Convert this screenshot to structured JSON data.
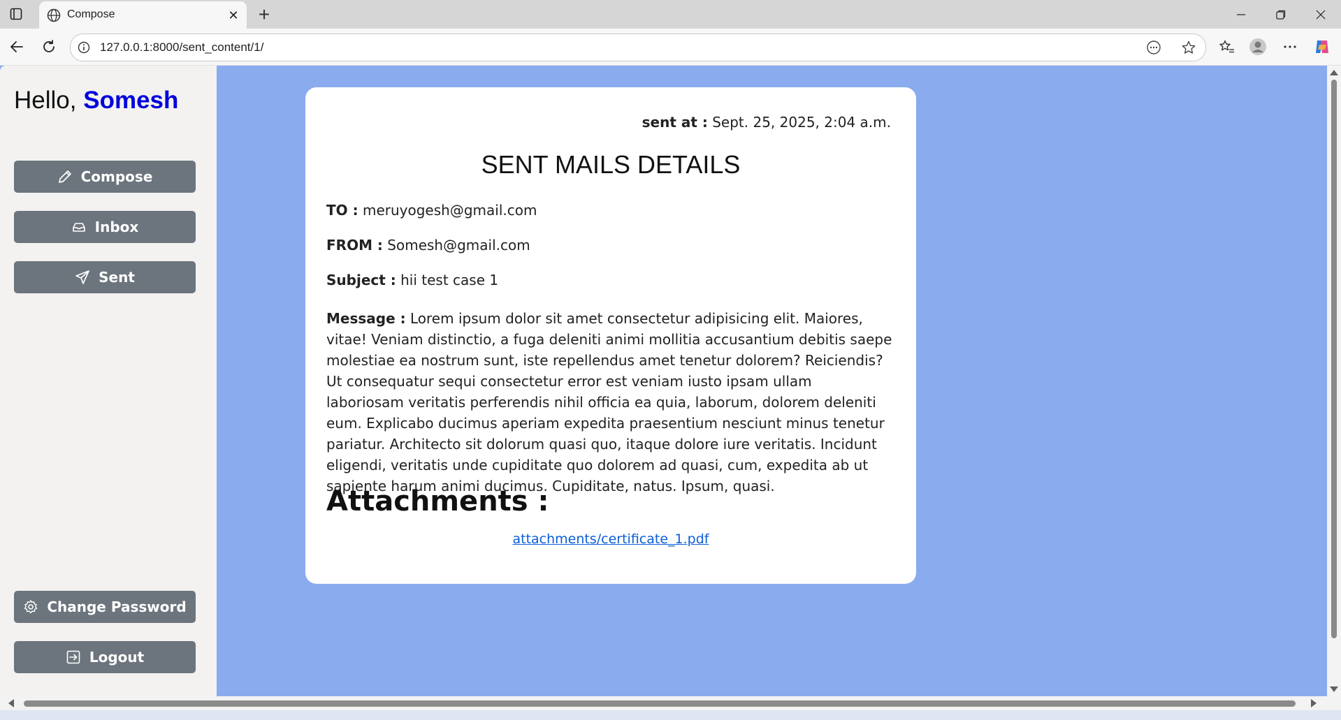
{
  "browser": {
    "tab_title": "Compose",
    "url": "127.0.0.1:8000/sent_content/1/"
  },
  "sidebar": {
    "greeting_prefix": "Hello,",
    "username": "Somesh",
    "nav": [
      {
        "label": "Compose",
        "icon": "pencil-icon"
      },
      {
        "label": "Inbox",
        "icon": "inbox-icon"
      },
      {
        "label": "Sent",
        "icon": "send-icon"
      }
    ],
    "bottom": [
      {
        "label": "Change Password",
        "icon": "gear-icon"
      },
      {
        "label": "Logout",
        "icon": "logout-icon"
      }
    ]
  },
  "mail": {
    "sent_at_label": "sent at :",
    "sent_at_value": "Sept. 25, 2025, 2:04 a.m.",
    "title": "SENT MAILS DETAILS",
    "to_label": "TO :",
    "to_value": "meruyogesh@gmail.com",
    "from_label": "FROM :",
    "from_value": "Somesh@gmail.com",
    "subject_label": "Subject :",
    "subject_value": "hii test case 1",
    "message_label": "Message :",
    "message_value": "Lorem ipsum dolor sit amet consectetur adipisicing elit. Maiores, vitae! Veniam distinctio, a fuga deleniti animi mollitia accusantium debitis saepe molestiae ea nostrum sunt, iste repellendus amet tenetur dolorem? Reiciendis? Ut consequatur sequi consectetur error est veniam iusto ipsam ullam laboriosam veritatis perferendis nihil officia ea quia, laborum, dolorem deleniti eum. Explicabo ducimus aperiam expedita praesentium nesciunt minus tenetur pariatur. Architecto sit dolorum quasi quo, itaque dolore iure veritatis. Incidunt eligendi, veritatis unde cupiditate quo dolorem ad quasi, cum, expedita ab ut sapiente harum animi ducimus. Cupiditate, natus. Ipsum, quasi.",
    "attachments_heading": "Attachments :",
    "attachment_link": "attachments/certificate_1.pdf"
  },
  "colors": {
    "page_bg": "#8aabee",
    "sidebar_bg": "#f3f2f1",
    "button_bg": "#6c757d",
    "username": "#0000dd",
    "link": "#0b5ed7"
  }
}
